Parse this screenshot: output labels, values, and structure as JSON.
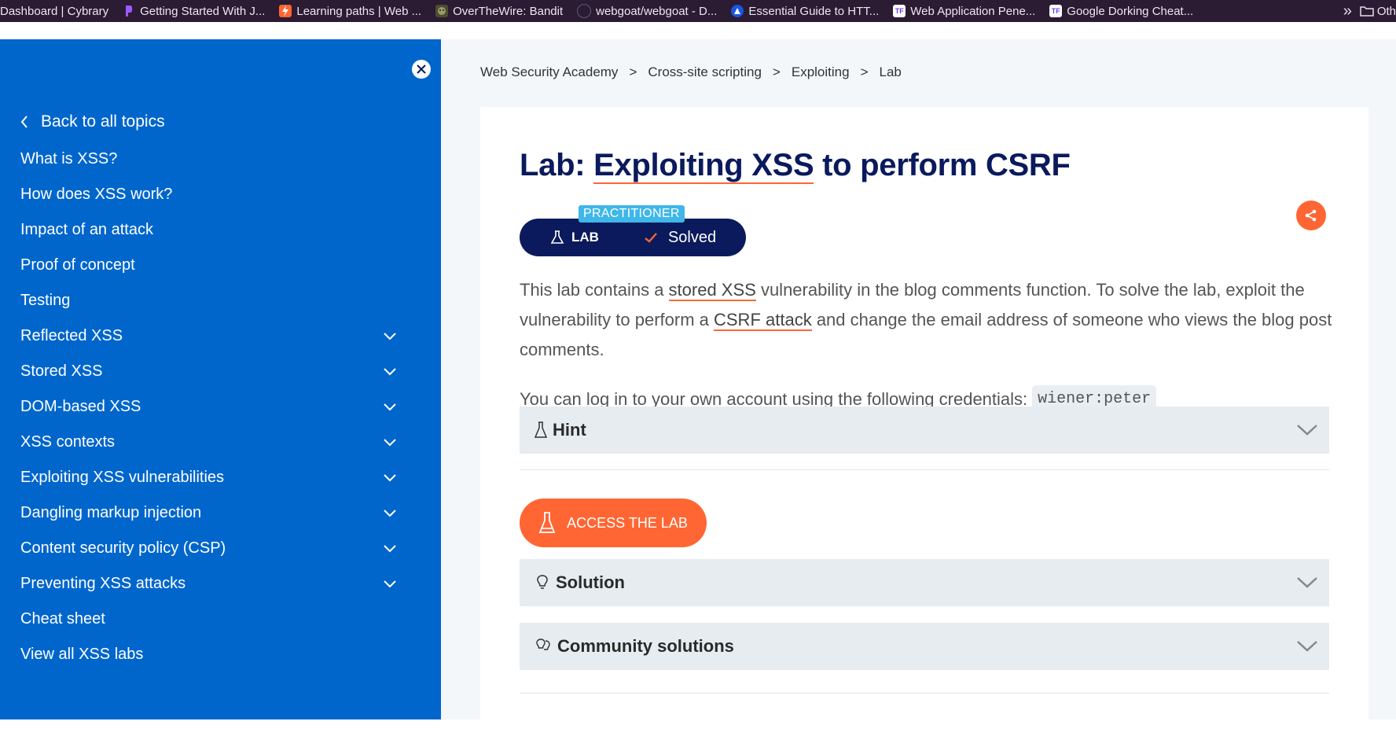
{
  "bookmarks": [
    {
      "label": "Dashboard | Cybrary",
      "icon": "cybrary-icon",
      "color": ""
    },
    {
      "label": "Getting Started With J...",
      "icon": "pluralsight-icon",
      "color": "#7b3cf0"
    },
    {
      "label": "Learning paths | Web ...",
      "icon": "portswigger-icon",
      "color": "#ff6633"
    },
    {
      "label": "OverTheWire: Bandit",
      "icon": "overthewire-icon",
      "color": "#6b6b3a"
    },
    {
      "label": "webgoat/webgoat - D...",
      "icon": "docker-icon",
      "color": "#3a3a5a"
    },
    {
      "label": "Essential Guide to HTT...",
      "icon": "triangle-icon",
      "color": "#1a56e0"
    },
    {
      "label": "Web Application Pene...",
      "icon": "tf-icon",
      "color": "#ffffff"
    },
    {
      "label": "Google Dorking Cheat...",
      "icon": "tf-icon",
      "color": "#ffffff"
    }
  ],
  "bookmarks_other": "Oth",
  "sidebar": {
    "back_label": "Back to all topics",
    "items": [
      {
        "label": "What is XSS?",
        "expandable": false
      },
      {
        "label": "How does XSS work?",
        "expandable": false
      },
      {
        "label": "Impact of an attack",
        "expandable": false
      },
      {
        "label": "Proof of concept",
        "expandable": false
      },
      {
        "label": "Testing",
        "expandable": false
      },
      {
        "label": "Reflected XSS",
        "expandable": true
      },
      {
        "label": "Stored XSS",
        "expandable": true
      },
      {
        "label": "DOM-based XSS",
        "expandable": true
      },
      {
        "label": "XSS contexts",
        "expandable": true
      },
      {
        "label": "Exploiting XSS vulnerabilities",
        "expandable": true
      },
      {
        "label": "Dangling markup injection",
        "expandable": true
      },
      {
        "label": "Content security policy (CSP)",
        "expandable": true
      },
      {
        "label": "Preventing XSS attacks",
        "expandable": true
      },
      {
        "label": "Cheat sheet",
        "expandable": false
      },
      {
        "label": "View all XSS labs",
        "expandable": false
      }
    ]
  },
  "breadcrumb": [
    "Web Security Academy",
    "Cross-site scripting",
    "Exploiting",
    "Lab"
  ],
  "breadcrumb_sep": ">",
  "lab": {
    "title_prefix": "Lab: ",
    "title_link": "Exploiting XSS",
    "title_suffix": " to perform CSRF",
    "level": "PRACTITIONER",
    "tag": "LAB",
    "status": "Solved",
    "desc_1": "This lab contains a ",
    "desc_link1": "stored XSS",
    "desc_2": " vulnerability in the blog comments function. To solve the lab, exploit the vulnerability to perform a ",
    "desc_link2": "CSRF attack",
    "desc_3": " and change the email address of someone who views the blog post comments.",
    "creds_text": "You can log in to your own account using the following credentials:",
    "creds_code": "wiener:peter",
    "hint_label": "Hint",
    "access_label": "ACCESS THE LAB",
    "solution_label": "Solution",
    "community_label": "Community solutions"
  },
  "colors": {
    "sidebar_bg": "#0066cc",
    "accent": "#ff6633",
    "navy": "#0a1a5c",
    "badge": "#3fb7e8"
  }
}
